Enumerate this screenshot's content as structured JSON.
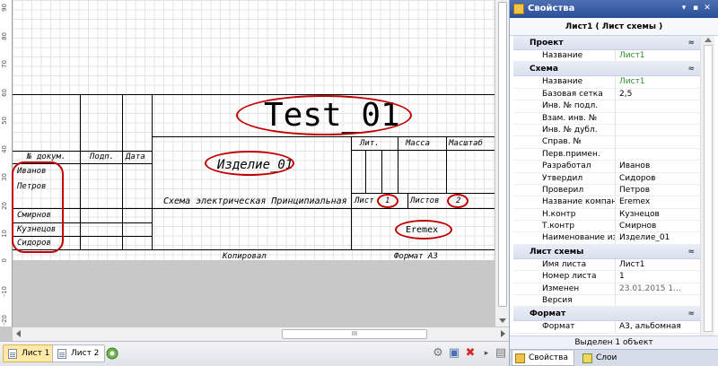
{
  "ruler": {
    "labels": [
      "90",
      "80",
      "70",
      "60",
      "50",
      "40",
      "30",
      "20",
      "10",
      "0",
      "-10",
      "-20"
    ]
  },
  "title_block": {
    "header_labels": {
      "doc_no": "№ докум.",
      "sign": "Подп.",
      "date": "Дата"
    },
    "names": [
      "Иванов",
      "Петров",
      "Смирнов",
      "Кузнецов",
      "Сидоров"
    ],
    "title": "Test_01",
    "product": "Изделие_01",
    "scheme_type": "Схема электрическая Принципиальная",
    "lit_label": "Лит.",
    "mass_label": "Масса",
    "scale_label": "Масштаб",
    "sheet_label": "Лист",
    "sheet_value": "1",
    "sheets_label": "Листов",
    "sheets_value": "2",
    "company": "Eremex",
    "copied": "Копировал",
    "format": "Формат А3"
  },
  "bottom_tabs": [
    {
      "label": "Лист 1",
      "active": true
    },
    {
      "label": "Лист 2",
      "active": false
    }
  ],
  "hscroll_grip": "III",
  "panel": {
    "title": "Свойства",
    "object_header": "Лист1 ( Лист схемы )",
    "categories": [
      {
        "name": "Проект",
        "rows": [
          {
            "key": "Название",
            "value": "Лист1",
            "style": "green"
          }
        ]
      },
      {
        "name": "Схема",
        "rows": [
          {
            "key": "Название",
            "value": "Лист1",
            "style": "green"
          },
          {
            "key": "Базовая сетка",
            "value": "2,5",
            "style": ""
          },
          {
            "key": "Инв. № подл.",
            "value": "",
            "style": ""
          },
          {
            "key": "Взам. инв. №",
            "value": "",
            "style": ""
          },
          {
            "key": "Инв. № дубл.",
            "value": "",
            "style": ""
          },
          {
            "key": "Справ. №",
            "value": "",
            "style": ""
          },
          {
            "key": "Перв.примен.",
            "value": "",
            "style": ""
          },
          {
            "key": "Разработал",
            "value": "Иванов",
            "style": ""
          },
          {
            "key": "Утвердил",
            "value": "Сидоров",
            "style": ""
          },
          {
            "key": "Проверил",
            "value": "Петров",
            "style": ""
          },
          {
            "key": "Название компании",
            "value": "Eremex",
            "style": ""
          },
          {
            "key": "Н.контр",
            "value": "Кузнецов",
            "style": ""
          },
          {
            "key": "Т.контр",
            "value": "Смирнов",
            "style": ""
          },
          {
            "key": "Наименование изделия",
            "value": "Изделие_01",
            "style": ""
          }
        ]
      },
      {
        "name": "Лист схемы",
        "rows": [
          {
            "key": "Имя листа",
            "value": "Лист1",
            "style": ""
          },
          {
            "key": "Номер листа",
            "value": "1",
            "style": ""
          },
          {
            "key": "Изменен",
            "value": "23.01.2015 1...",
            "style": "dim"
          },
          {
            "key": "Версия",
            "value": "",
            "style": ""
          }
        ]
      },
      {
        "name": "Формат",
        "rows": [
          {
            "key": "Формат",
            "value": "А3, альбомная",
            "style": ""
          }
        ]
      }
    ],
    "status": "Выделен 1 объект",
    "tabs": [
      {
        "label": "Свойства",
        "active": true
      },
      {
        "label": "Слои",
        "active": false
      }
    ]
  },
  "colors": {
    "highlight": "#c00000",
    "panel_title": "#2a4f9a",
    "active_tab": "#ffe9a8"
  }
}
